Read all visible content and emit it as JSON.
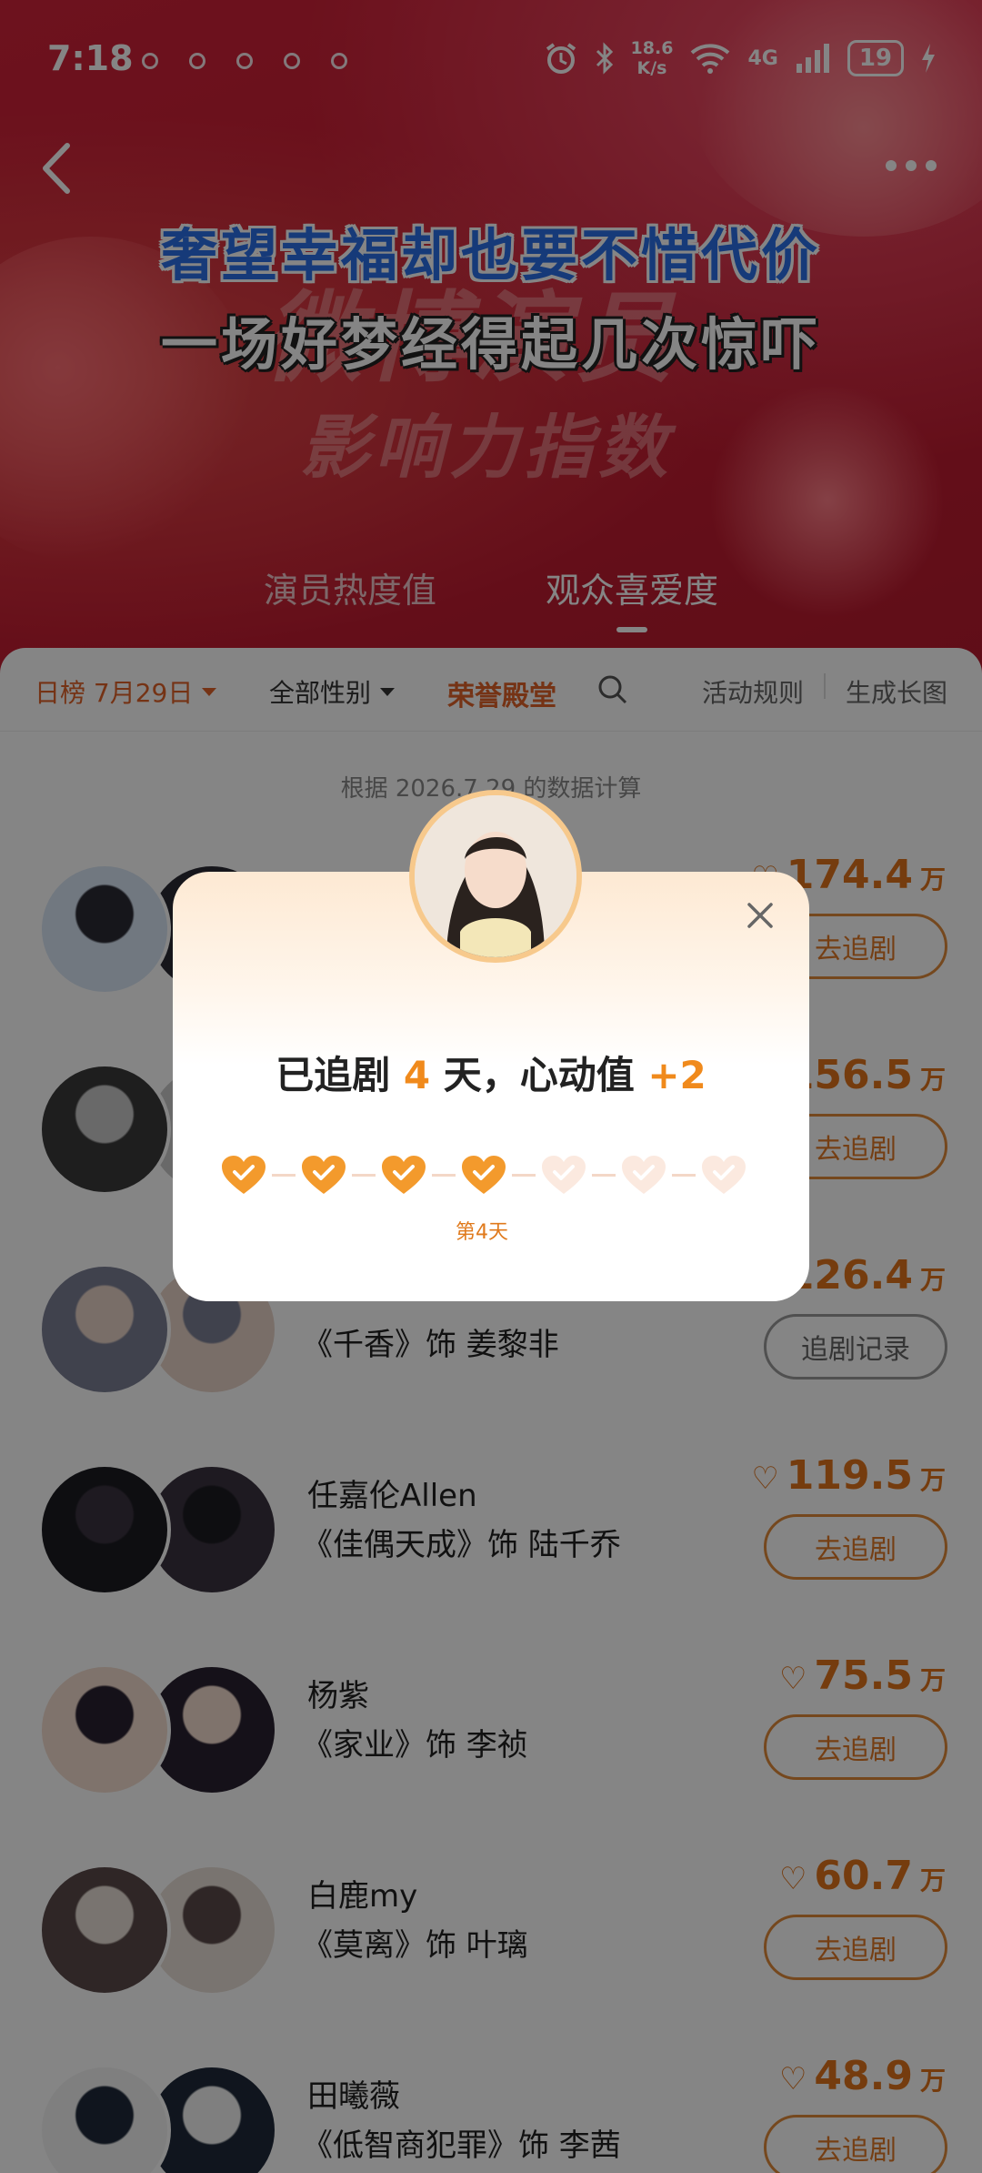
{
  "status_bar": {
    "time": "7:18",
    "net_speed_value": "18.6",
    "net_speed_unit": "K/s",
    "network": "4G",
    "battery": "19"
  },
  "header": {
    "banner_title": "微博演员",
    "banner_subtitle": "影响力指数",
    "overlay_line_1": "奢望幸福却也要不惜代价",
    "overlay_line_2": "一场好梦经得起几次惊吓",
    "tabs": [
      {
        "label": "演员热度值",
        "active": false
      },
      {
        "label": "观众喜爱度",
        "active": true
      }
    ]
  },
  "filters": {
    "date": "日榜 7月29日",
    "gender": "全部性别",
    "honor": "荣誉殿堂",
    "rules": "活动规则",
    "chart": "生成长图"
  },
  "data_note": "根据 2026.7.29 的数据计算",
  "rank_list": [
    {
      "name": "",
      "role": "",
      "score": "174.4",
      "unit": "万",
      "button": "去追剧"
    },
    {
      "name": "",
      "role": "",
      "score": "156.5",
      "unit": "万",
      "button": "去追剧"
    },
    {
      "name": "",
      "role": "《千香》饰 姜黎非",
      "score": "126.4",
      "unit": "万",
      "button": "追剧记录"
    },
    {
      "name": "任嘉伦Allen",
      "role": "《佳偶天成》饰 陆千乔",
      "score": "119.5",
      "unit": "万",
      "button": "去追剧"
    },
    {
      "name": "杨紫",
      "role": "《家业》饰 李祯",
      "score": "75.5",
      "unit": "万",
      "button": "去追剧"
    },
    {
      "name": "白鹿my",
      "role": "《莫离》饰 叶璃",
      "score": "60.7",
      "unit": "万",
      "button": "去追剧"
    },
    {
      "name": "田曦薇",
      "role": "《低智商犯罪》饰 李茜",
      "score": "48.9",
      "unit": "万",
      "button": "去追剧"
    }
  ],
  "modal": {
    "title_prefix": "已追剧",
    "days": "4",
    "title_mid": "天，心动值",
    "bonus": "+2",
    "streak_total": 7,
    "streak_done": 4,
    "streak_label": "第4天"
  },
  "colors": {
    "accent": "#e0741c",
    "hero_red": "#c81e33",
    "overlay_blue": "#2b6fe8"
  }
}
